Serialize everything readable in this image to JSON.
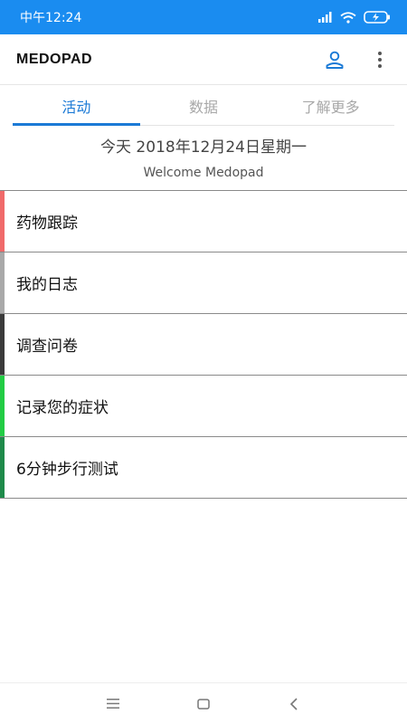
{
  "status_bar": {
    "time": "中午12:24",
    "background": "#1a8cf0"
  },
  "app_bar": {
    "title": "MEDOPAD",
    "profile_icon": "person-icon",
    "menu_icon": "more-vert-icon"
  },
  "tabs": [
    {
      "label": "活动",
      "active": true
    },
    {
      "label": "数据",
      "active": false
    },
    {
      "label": "了解更多",
      "active": false
    }
  ],
  "header": {
    "date": "今天 2018年12月24日星期一",
    "welcome": "Welcome Medopad"
  },
  "activities": [
    {
      "label": "药物跟踪",
      "color": "#f06a6a"
    },
    {
      "label": "我的日志",
      "color": "#a9a9a9"
    },
    {
      "label": "调查问卷",
      "color": "#3a3a3a"
    },
    {
      "label": "记录您的症状",
      "color": "#22cc44"
    },
    {
      "label": "6分钟步行测试",
      "color": "#1e8a4a"
    }
  ],
  "colors": {
    "accent": "#1b7ad6",
    "tab_inactive": "#a8a8a8"
  }
}
